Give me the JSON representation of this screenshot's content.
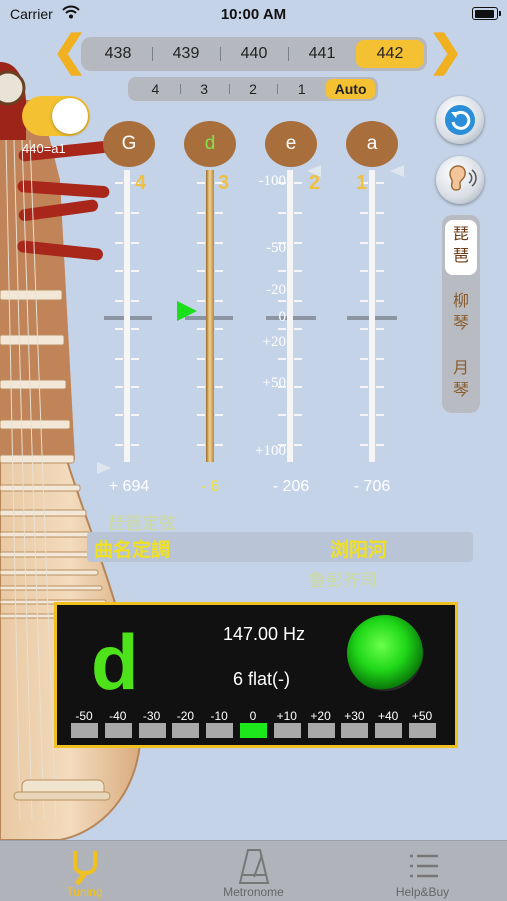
{
  "status_bar": {
    "carrier": "Carrier",
    "time": "10:00 AM"
  },
  "reference_pitch": {
    "options": [
      "438",
      "439",
      "440",
      "441",
      "442"
    ],
    "selected": "442"
  },
  "string_select": {
    "options": [
      "4",
      "3",
      "2",
      "1",
      "Auto"
    ],
    "selected": "Auto"
  },
  "toggle": {
    "label": "440=a1",
    "on": true
  },
  "strings": [
    {
      "note": "G",
      "number": "4",
      "cents": "+ 694"
    },
    {
      "note": "d",
      "number": "3",
      "cents": "- 6",
      "active": true
    },
    {
      "note": "e",
      "number": "2",
      "cents": "- 206"
    },
    {
      "note": "a",
      "number": "1",
      "cents": "- 706"
    }
  ],
  "scale_labels": [
    "-100",
    "-50",
    "-20",
    "0",
    "+20",
    "+50",
    "+100"
  ],
  "instruments": [
    {
      "label": "琵琶",
      "selected": true
    },
    {
      "label": "柳琴"
    },
    {
      "label": "月琴"
    }
  ],
  "tune": {
    "above": "琵琶定弦",
    "label": "曲名定調",
    "song": "浏阳河",
    "below": "鲁彭齐司"
  },
  "display": {
    "note": "d",
    "frequency": "147.00 Hz",
    "deviation": "6  flat(-)",
    "scale": [
      "-50",
      "-40",
      "-30",
      "-20",
      "-10",
      "0",
      "+10",
      "+20",
      "+30",
      "+40",
      "+50"
    ],
    "active_index": 5
  },
  "tabs": [
    {
      "label": "Tuning",
      "selected": true,
      "icon": "tuning-fork-icon"
    },
    {
      "label": "Metronome",
      "icon": "metronome-icon"
    },
    {
      "label": "Help&Buy",
      "icon": "list-icon"
    }
  ],
  "colors": {
    "accent": "#f0c020",
    "background": "#c4d3e8",
    "in_tune": "#1ce81c",
    "note_circle": "#a86f3c"
  }
}
